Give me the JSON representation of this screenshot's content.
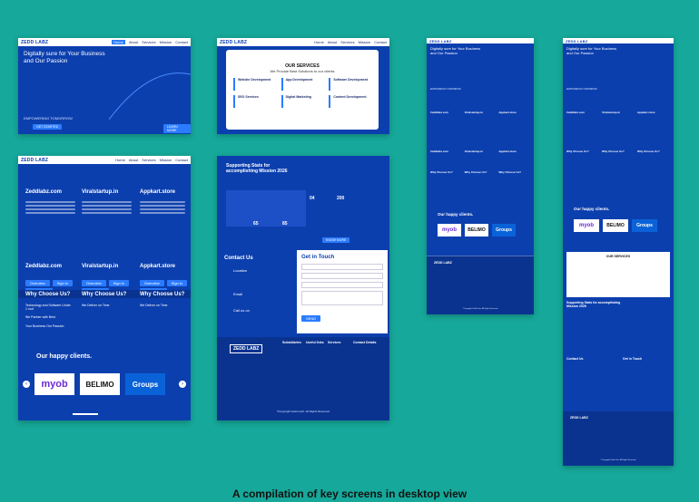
{
  "caption": "A compilation of key screens in desktop view",
  "brand": "ZEDD LABZ",
  "nav": [
    "Home",
    "About",
    "Services",
    "Mission",
    "Contact"
  ],
  "hero": {
    "title": "Digitally sure for Your Business and Our Passion",
    "tag": "EMPOWERING TOMORROW",
    "cta": "GET STARTED",
    "cta2": "LEARN MORE"
  },
  "services": {
    "title": "OUR SERVICES",
    "subtitle": "We Provide Best Solutions to our clients",
    "items": [
      "Website Development",
      "App Development",
      "Software Development",
      "SEO Services",
      "Digital Marketing",
      "Content Development"
    ]
  },
  "ventures": {
    "sites": [
      "Zeddlabz.com",
      "Viralstartup.in",
      "Appkart.store"
    ],
    "buttons": [
      "Overview",
      "Sign in",
      "Contact Us"
    ],
    "why_title": "Why Choose Us?",
    "why_items": [
      "Technology and Software Under 1 roof",
      "We Partner with Best",
      "We Deliver on Time",
      "Your Business Our Passion"
    ]
  },
  "clients": {
    "title": "Our happy clients.",
    "logos": [
      "myob",
      "BELIMO",
      "Groups"
    ]
  },
  "stats": {
    "title": "Supporting Stats for accomplishing Mission 2026",
    "numbers": [
      "04",
      "200",
      "65",
      "85"
    ],
    "cta": "KNOW MORE"
  },
  "contact": {
    "title": "Contact Us",
    "labels": [
      "Location",
      "Email",
      "Call us on"
    ],
    "form_title": "Get in Touch",
    "fields": [
      "First Name",
      "Email",
      "Subject",
      "Your Message"
    ],
    "send": "SEND"
  },
  "footer": {
    "cols": [
      "Subsidiaries",
      "Useful links",
      "Services",
      "Contact Details"
    ],
    "copy": "©Copyright Zedd Labz. All Rights Reserved"
  },
  "colors": {
    "page_bg": "#16a89a",
    "brand_blue": "#0c3fae",
    "accent": "#2b7bff"
  }
}
